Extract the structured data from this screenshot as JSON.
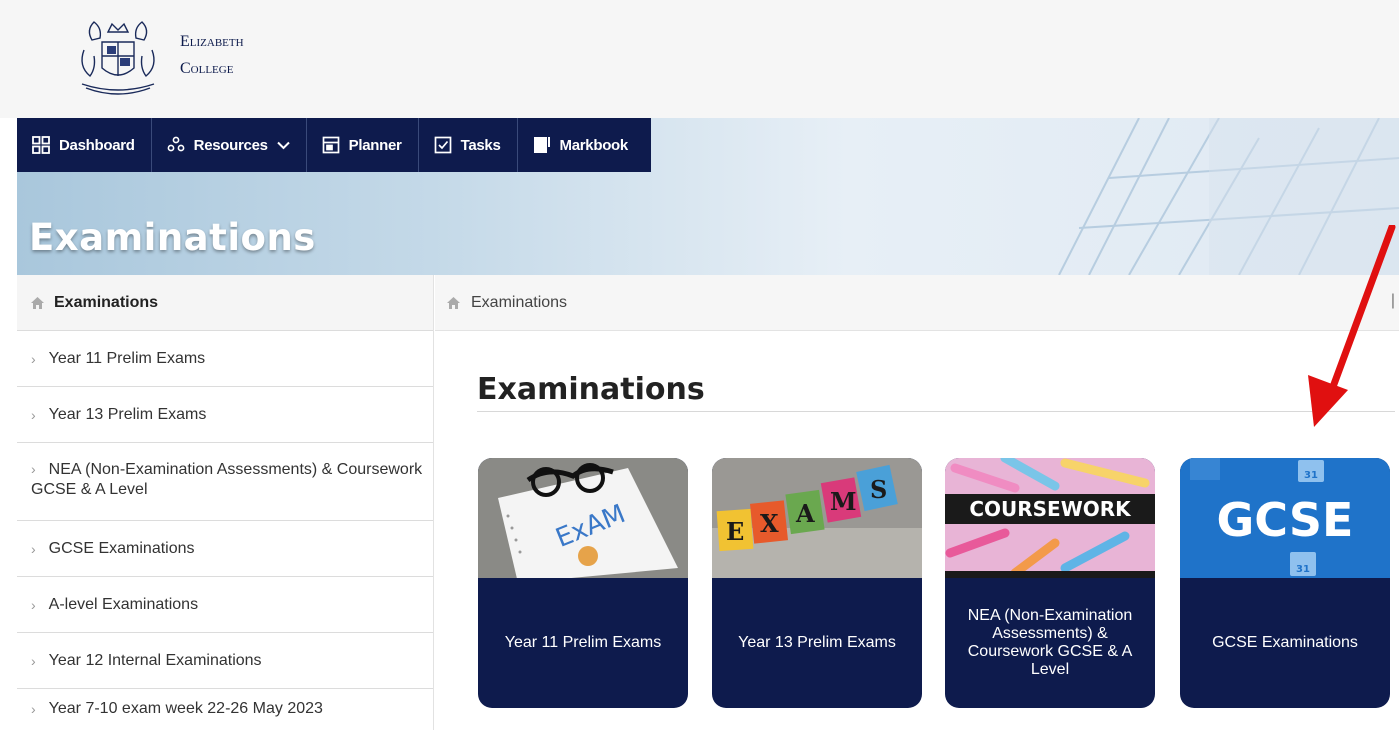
{
  "brand": {
    "line1": "Elizabeth",
    "line2": "College"
  },
  "nav": [
    {
      "label": "Dashboard",
      "icon": "dashboard-icon"
    },
    {
      "label": "Resources",
      "icon": "resources-icon",
      "dropdown": true
    },
    {
      "label": "Planner",
      "icon": "planner-icon"
    },
    {
      "label": "Tasks",
      "icon": "tasks-icon"
    },
    {
      "label": "Markbook",
      "icon": "markbook-icon"
    }
  ],
  "hero": {
    "title": "Examinations"
  },
  "sidebar": {
    "header": "Examinations",
    "items": [
      "Year 11 Prelim Exams",
      "Year 13 Prelim Exams",
      "NEA (Non-Examination Assessments) & Coursework GCSE & A Level",
      "GCSE Examinations",
      "A-level Examinations",
      "Year 12 Internal Examinations",
      "Year 7-10 exam week 22-26 May 2023"
    ]
  },
  "breadcrumb": {
    "current": "Examinations"
  },
  "main": {
    "title": "Examinations"
  },
  "cards": [
    {
      "label": "Year 11 Prelim Exams",
      "image_text": "ExAM"
    },
    {
      "label": "Year 13 Prelim Exams",
      "image_text": "EXAMS"
    },
    {
      "label": "NEA (Non-Examination Assessments) & Coursework GCSE & A Level",
      "image_text": "COURSEWORK"
    },
    {
      "label": "GCSE Examinations",
      "image_text": "GCSE"
    }
  ],
  "colors": {
    "navy": "#0e1b4d",
    "annotation_arrow": "#e01010"
  }
}
